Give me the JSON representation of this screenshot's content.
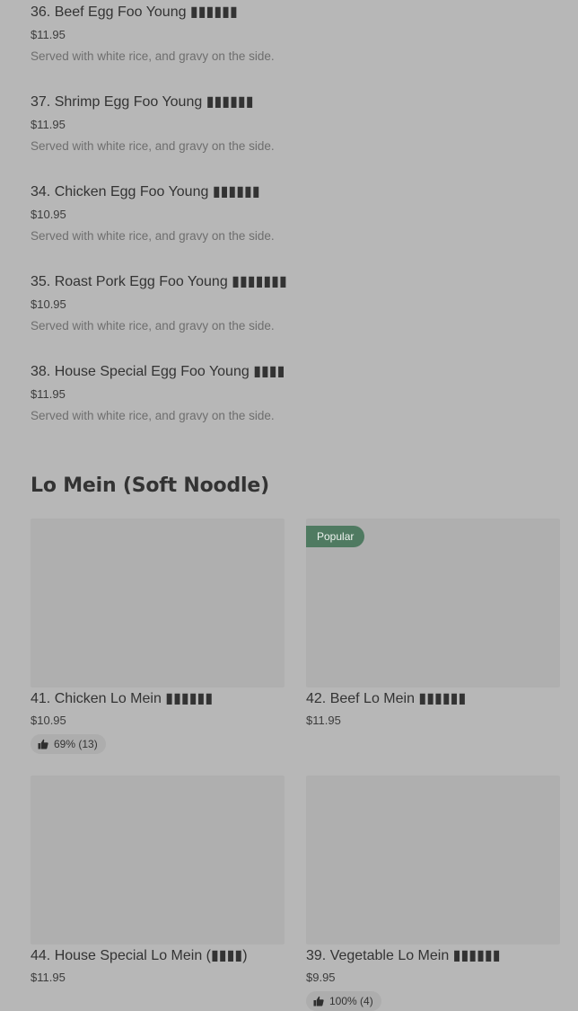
{
  "egg_foo_young_items": [
    {
      "name": "36. Beef Egg Foo Young ▮▮▮▮▮▮",
      "price": "$11.95",
      "description": "Served with white rice, and gravy on the side."
    },
    {
      "name": "37. Shrimp Egg Foo Young ▮▮▮▮▮▮",
      "price": "$11.95",
      "description": "Served with white rice, and gravy on the side."
    },
    {
      "name": "34. Chicken Egg Foo Young ▮▮▮▮▮▮",
      "price": "$10.95",
      "description": "Served with white rice, and gravy on the side."
    },
    {
      "name": "35. Roast Pork Egg Foo Young ▮▮▮▮▮▮▮",
      "price": "$10.95",
      "description": "Served with white rice, and gravy on the side."
    },
    {
      "name": "38. House Special Egg Foo Young ▮▮▮▮",
      "price": "$11.95",
      "description": "Served with white rice, and gravy on the side."
    }
  ],
  "lo_mein_section": {
    "title": "Lo Mein (Soft Noodle)",
    "cards": [
      {
        "name": "41. Chicken Lo Mein  ▮▮▮▮▮▮",
        "price": "$10.95",
        "rating": "69% (13)",
        "badge": ""
      },
      {
        "name": "42. Beef Lo Mein  ▮▮▮▮▮▮",
        "price": "$11.95",
        "rating": "",
        "badge": "Popular"
      },
      {
        "name": "44. House Special Lo Mein (▮▮▮▮)",
        "price": "$11.95",
        "rating": "",
        "badge": ""
      },
      {
        "name": "39. Vegetable Lo Mein  ▮▮▮▮▮▮",
        "price": "$9.95",
        "rating": "100% (4)",
        "badge": ""
      }
    ]
  },
  "icons": {
    "rating": "thumbs-up-icon"
  },
  "colors": {
    "background": "#b7b7b7",
    "popular_badge": "#4f7a61",
    "card_image": "#afafaf"
  }
}
